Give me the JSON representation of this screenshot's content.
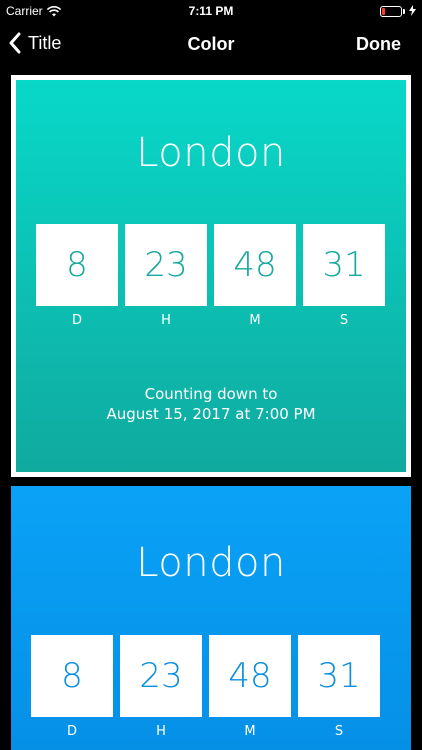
{
  "status_bar": {
    "carrier": "Carrier",
    "time": "7:11 PM",
    "battery_color": "#ff3b30"
  },
  "nav": {
    "back_label": "Title",
    "title": "Color",
    "done_label": "Done"
  },
  "cards": [
    {
      "color_theme": "teal",
      "gradient": [
        "#08d8c9",
        "#10aa9f"
      ],
      "selected": true,
      "city": "London",
      "countdown": [
        {
          "value": "8",
          "unit": "D"
        },
        {
          "value": "23",
          "unit": "H"
        },
        {
          "value": "48",
          "unit": "M"
        },
        {
          "value": "31",
          "unit": "S"
        }
      ],
      "caption_line1": "Counting down to",
      "caption_line2": "August 15, 2017 at 7:00 PM"
    },
    {
      "color_theme": "blue",
      "gradient": [
        "#0aa2f7",
        "#0590e6"
      ],
      "selected": false,
      "city": "London",
      "countdown": [
        {
          "value": "8",
          "unit": "D"
        },
        {
          "value": "23",
          "unit": "H"
        },
        {
          "value": "48",
          "unit": "M"
        },
        {
          "value": "31",
          "unit": "S"
        }
      ]
    }
  ]
}
